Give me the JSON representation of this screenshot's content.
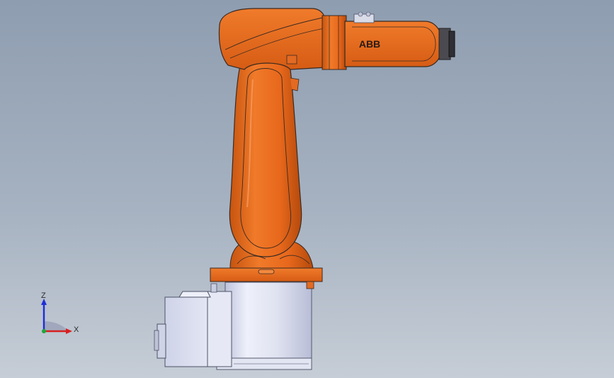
{
  "viewport": {
    "background_top": "#8e9db0",
    "background_bottom": "#c6cdd6"
  },
  "model": {
    "brand_label": "ABB",
    "arm_color": "#e96a1f",
    "arm_shade": "#b54a0f",
    "base_color": "#dfe2ef",
    "motor_box_color": "#d9dcec",
    "edge_color": "#3a2a22"
  },
  "triad": {
    "z_label": "Z",
    "x_label": "X",
    "z_color": "#1f2fd6",
    "x_color": "#d62020",
    "y_color": "#1ea83a"
  }
}
